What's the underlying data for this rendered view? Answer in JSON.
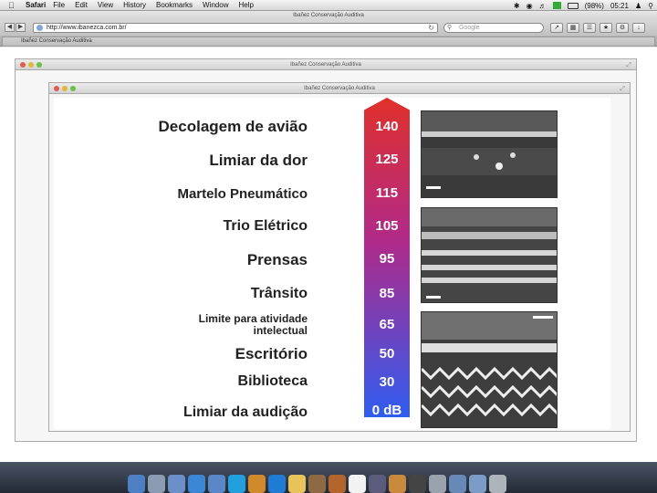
{
  "menubar": {
    "app": "Safari",
    "items": [
      "File",
      "Edit",
      "View",
      "History",
      "Bookmarks",
      "Window",
      "Help"
    ],
    "battery": "(98%)",
    "clock": "05:21"
  },
  "browser": {
    "window_title": "Ibañez Conservação Auditiva",
    "url": "http://www.ibanezca.com.br/",
    "search_placeholder": "Google",
    "tab_title": "Ibañez Conservação Auditiva"
  },
  "app_window": {
    "title": "Ibañez Conservação Auditiva"
  },
  "inner_window": {
    "title": "Ibañez Conservação Auditiva"
  },
  "chart": {
    "levels": [
      {
        "label": "Decolagem de avião",
        "db": "140"
      },
      {
        "label": "Limiar da dor",
        "db": "125"
      },
      {
        "label": "Martelo Pneumático",
        "db": "115"
      },
      {
        "label": "Trio Elétrico",
        "db": "105"
      },
      {
        "label": "Prensas",
        "db": "95"
      },
      {
        "label": "Trânsito",
        "db": "85"
      },
      {
        "label_line1": "Limite para atividade",
        "label_line2": "intelectual",
        "db": "65"
      },
      {
        "label": "Escritório",
        "db": "50"
      },
      {
        "label": "Biblioteca",
        "db": "30"
      },
      {
        "label": "Limiar da audição",
        "db": "0 dB"
      }
    ],
    "gradient_top": "#e0302a",
    "gradient_bottom": "#2f5cf0"
  }
}
